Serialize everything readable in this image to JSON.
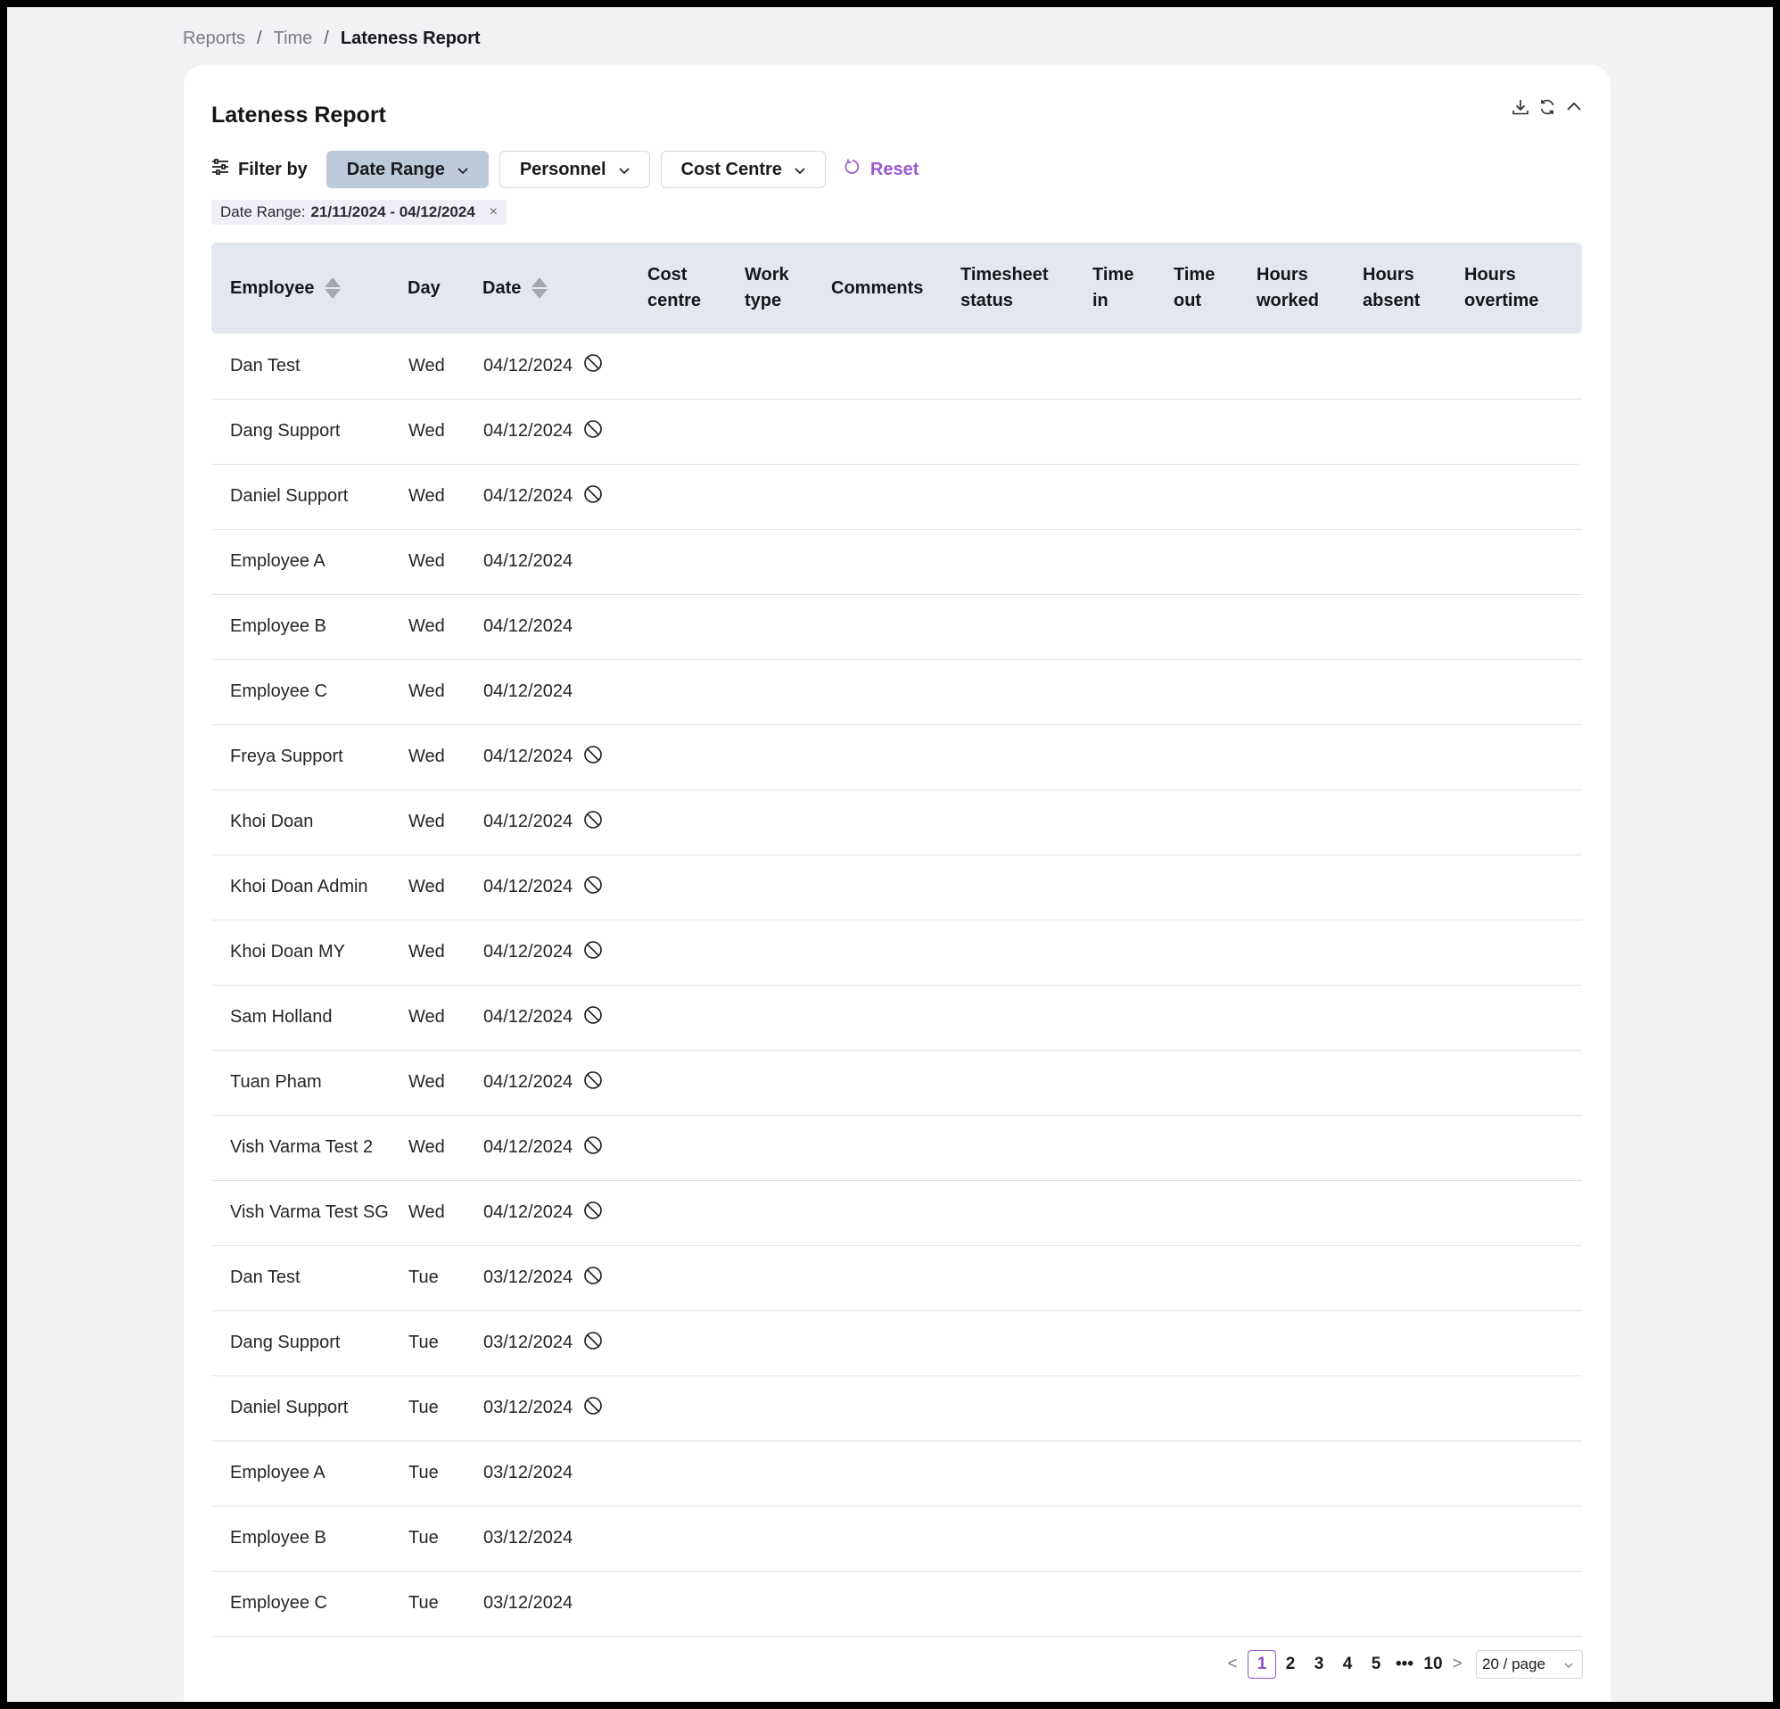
{
  "breadcrumb": {
    "items": [
      "Reports",
      "Time"
    ],
    "separator": "/",
    "current": "Lateness Report"
  },
  "card": {
    "title": "Lateness Report",
    "actions": [
      "download-icon",
      "refresh-icon",
      "collapse-icon"
    ]
  },
  "filters": {
    "label": "Filter by",
    "buttons": [
      {
        "label": "Date Range",
        "active": true
      },
      {
        "label": "Personnel",
        "active": false
      },
      {
        "label": "Cost Centre",
        "active": false
      }
    ],
    "reset_label": "Reset",
    "active_chip": {
      "key": "Date Range:",
      "value": "21/11/2024 - 04/12/2024",
      "close": "×"
    }
  },
  "table": {
    "columns": [
      {
        "label": "Employee",
        "sortable": true
      },
      {
        "label": "Day",
        "sortable": false
      },
      {
        "label": "Date",
        "sortable": true
      },
      {
        "label": "Cost centre",
        "sortable": false
      },
      {
        "label": "Work type",
        "sortable": false
      },
      {
        "label": "Comments",
        "sortable": false
      },
      {
        "label": "Timesheet status",
        "sortable": false
      },
      {
        "label": "Time in",
        "sortable": false
      },
      {
        "label": "Time out",
        "sortable": false
      },
      {
        "label": "Hours worked",
        "sortable": false
      },
      {
        "label": "Hours absent",
        "sortable": false
      },
      {
        "label": "Hours overtime",
        "sortable": false
      }
    ],
    "rows": [
      {
        "employee": "Dan Test",
        "day": "Wed",
        "date": "04/12/2024",
        "blocked": true
      },
      {
        "employee": "Dang Support",
        "day": "Wed",
        "date": "04/12/2024",
        "blocked": true
      },
      {
        "employee": "Daniel Support",
        "day": "Wed",
        "date": "04/12/2024",
        "blocked": true
      },
      {
        "employee": "Employee A",
        "day": "Wed",
        "date": "04/12/2024",
        "blocked": false
      },
      {
        "employee": "Employee B",
        "day": "Wed",
        "date": "04/12/2024",
        "blocked": false
      },
      {
        "employee": "Employee C",
        "day": "Wed",
        "date": "04/12/2024",
        "blocked": false
      },
      {
        "employee": "Freya Support",
        "day": "Wed",
        "date": "04/12/2024",
        "blocked": true
      },
      {
        "employee": "Khoi Doan",
        "day": "Wed",
        "date": "04/12/2024",
        "blocked": true
      },
      {
        "employee": "Khoi Doan Admin",
        "day": "Wed",
        "date": "04/12/2024",
        "blocked": true
      },
      {
        "employee": "Khoi Doan MY",
        "day": "Wed",
        "date": "04/12/2024",
        "blocked": true
      },
      {
        "employee": "Sam Holland",
        "day": "Wed",
        "date": "04/12/2024",
        "blocked": true
      },
      {
        "employee": "Tuan Pham",
        "day": "Wed",
        "date": "04/12/2024",
        "blocked": true
      },
      {
        "employee": "Vish Varma Test 2",
        "day": "Wed",
        "date": "04/12/2024",
        "blocked": true
      },
      {
        "employee": "Vish Varma Test SG",
        "day": "Wed",
        "date": "04/12/2024",
        "blocked": true
      },
      {
        "employee": "Dan Test",
        "day": "Tue",
        "date": "03/12/2024",
        "blocked": true
      },
      {
        "employee": "Dang Support",
        "day": "Tue",
        "date": "03/12/2024",
        "blocked": true
      },
      {
        "employee": "Daniel Support",
        "day": "Tue",
        "date": "03/12/2024",
        "blocked": true
      },
      {
        "employee": "Employee A",
        "day": "Tue",
        "date": "03/12/2024",
        "blocked": false
      },
      {
        "employee": "Employee B",
        "day": "Tue",
        "date": "03/12/2024",
        "blocked": false
      },
      {
        "employee": "Employee C",
        "day": "Tue",
        "date": "03/12/2024",
        "blocked": false
      }
    ]
  },
  "pagination": {
    "prev": "<",
    "next": ">",
    "pages": [
      "1",
      "2",
      "3",
      "4",
      "5"
    ],
    "ellipsis": "•••",
    "last": "10",
    "current": "1",
    "page_size": "20 / page"
  },
  "colors": {
    "accent": "#9b59d0",
    "header_bg": "#e3e8ef",
    "active_filter_bg": "#bcc9da",
    "page_bg": "#f1f2f4"
  }
}
